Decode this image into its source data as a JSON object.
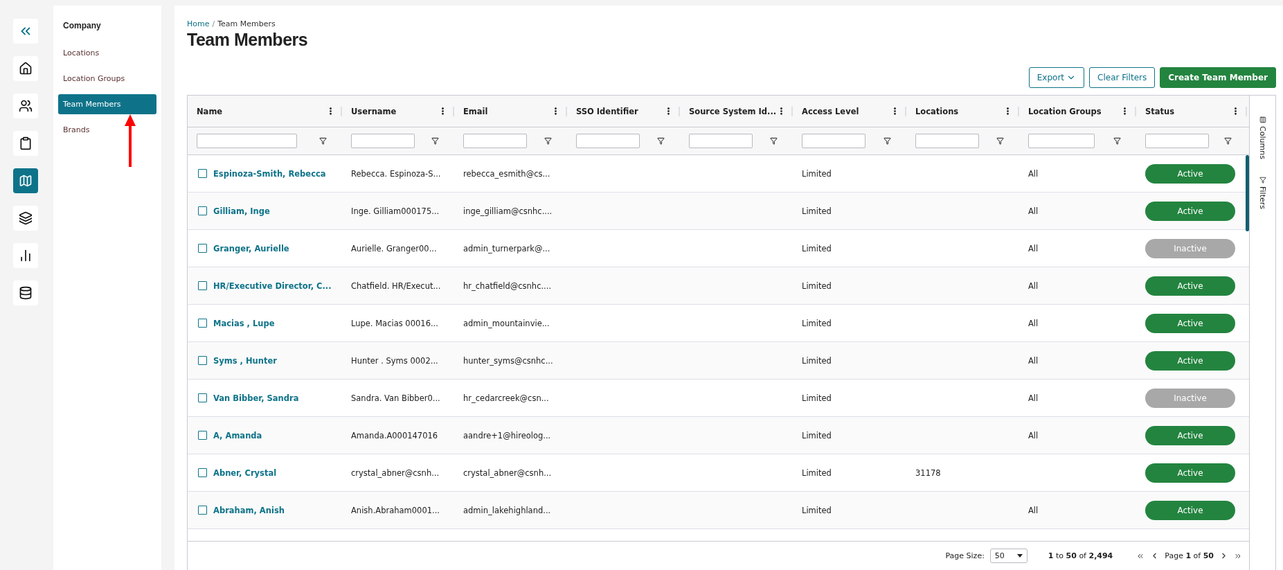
{
  "icon_rail": {
    "items": [
      {
        "selected": false
      },
      {
        "selected": false
      },
      {
        "selected": false
      },
      {
        "selected": false
      },
      {
        "selected": true
      },
      {
        "selected": false
      },
      {
        "selected": false
      },
      {
        "selected": false
      }
    ]
  },
  "subnav": {
    "title": "Company",
    "items": [
      {
        "label": "Locations",
        "selected": false
      },
      {
        "label": "Location Groups",
        "selected": false
      },
      {
        "label": "Team Members",
        "selected": true
      },
      {
        "label": "Brands",
        "selected": false
      }
    ]
  },
  "breadcrumb": [
    {
      "label": "Home"
    },
    {
      "label": "Team Members"
    }
  ],
  "breadcrumb_separator": "/",
  "page_title": "Team Members",
  "actions": [
    {
      "label": "Export",
      "kind": "dropdown"
    },
    {
      "label": "Clear Filters",
      "kind": "outline"
    },
    {
      "label": "Create Team Member",
      "kind": "primary"
    }
  ],
  "table": {
    "columns": [
      "Name",
      "Username",
      "Email",
      "SSO Identifier",
      "Source System Id...",
      "Access Level",
      "Locations",
      "Location Groups",
      "Status"
    ],
    "rows": [
      {
        "checked": false,
        "name": "Espinoza-Smith, Rebecca",
        "username": "Rebecca. Espinoza-S...",
        "email": "rebecca_esmith@cs...",
        "access_level": "Limited",
        "locations": "",
        "location_groups": "All",
        "status": "Active",
        "active": true
      },
      {
        "checked": false,
        "name": "Gilliam, Inge",
        "username": "Inge. Gilliam000175...",
        "email": "inge_gilliam@csnhc....",
        "access_level": "Limited",
        "locations": "",
        "location_groups": "All",
        "status": "Active",
        "active": true
      },
      {
        "checked": false,
        "name": "Granger, Aurielle",
        "username": "Aurielle. Granger00...",
        "email": "admin_turnerpark@...",
        "access_level": "Limited",
        "locations": "",
        "location_groups": "All",
        "status": "Inactive",
        "active": false
      },
      {
        "checked": false,
        "name": "HR/Executive Director, C...",
        "username": "Chatfield. HR/Execut...",
        "email": "hr_chatfield@csnhc....",
        "access_level": "Limited",
        "locations": "",
        "location_groups": "All",
        "status": "Active",
        "active": true
      },
      {
        "checked": false,
        "name": "Macias , Lupe",
        "username": "Lupe. Macias 00016...",
        "email": "admin_mountainvie...",
        "access_level": "Limited",
        "locations": "",
        "location_groups": "All",
        "status": "Active",
        "active": true
      },
      {
        "checked": false,
        "name": "Syms , Hunter",
        "username": "Hunter . Syms 0002...",
        "email": "hunter_syms@csnhc...",
        "access_level": "Limited",
        "locations": "",
        "location_groups": "All",
        "status": "Active",
        "active": true
      },
      {
        "checked": false,
        "name": "Van Bibber, Sandra",
        "username": "Sandra. Van Bibber0...",
        "email": "hr_cedarcreek@csn...",
        "access_level": "Limited",
        "locations": "",
        "location_groups": "All",
        "status": "Inactive",
        "active": false
      },
      {
        "checked": false,
        "name": "A, Amanda",
        "username": "Amanda.A000147016",
        "email": "aandre+1@hireolog...",
        "access_level": "Limited",
        "locations": "",
        "location_groups": "All",
        "status": "Active",
        "active": true
      },
      {
        "checked": false,
        "name": "Abner, Crystal",
        "username": "crystal_abner@csnh...",
        "email": "crystal_abner@csnh...",
        "access_level": "Limited",
        "locations": "31178",
        "location_groups": "",
        "status": "Active",
        "active": true
      },
      {
        "checked": false,
        "name": "Abraham, Anish",
        "username": "Anish.Abraham0001...",
        "email": "admin_lakehighland...",
        "access_level": "Limited",
        "locations": "",
        "location_groups": "All",
        "status": "Active",
        "active": true
      }
    ]
  },
  "side_panel": [
    {
      "label": "Columns",
      "kind": "columns"
    },
    {
      "label": "Filters",
      "kind": "filters"
    }
  ],
  "pagination": {
    "page_size_label": "Page Size:",
    "page_size": "50",
    "range_start": "1",
    "range_to": "to",
    "range_end": "50",
    "range_of": "of",
    "total": "2,494",
    "page_label": "Page",
    "page": "1",
    "page_of": "of",
    "pages": "50"
  }
}
